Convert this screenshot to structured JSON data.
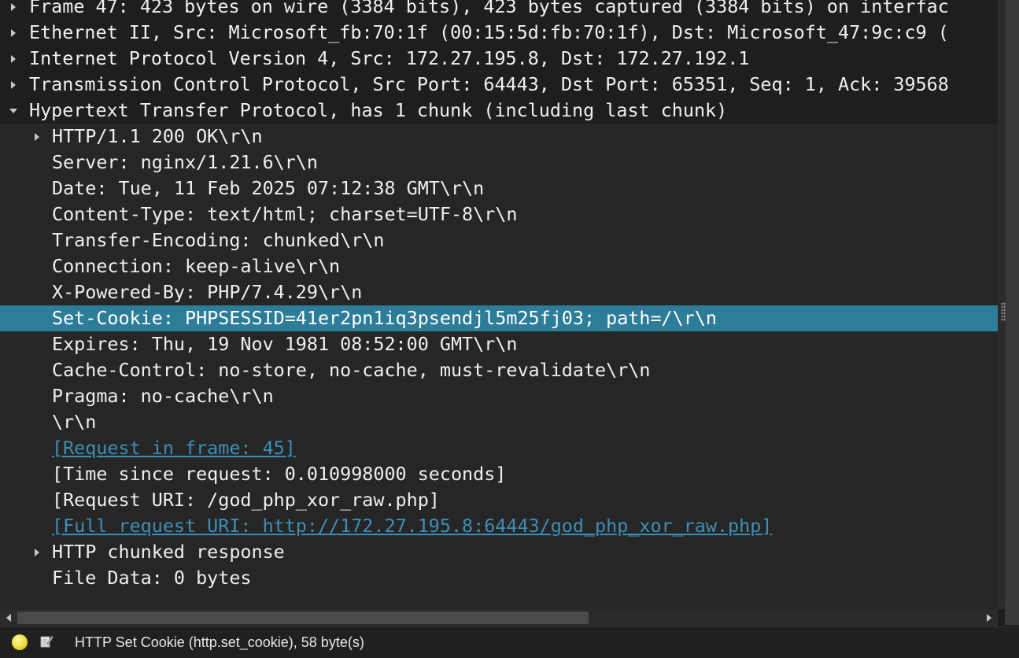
{
  "tree": {
    "top_rows": [
      {
        "text": "Frame 47: 423 bytes on wire (3384 bits), 423 bytes captured (3384 bits) on interfac",
        "expanded": false
      },
      {
        "text": "Ethernet II, Src: Microsoft_fb:70:1f (00:15:5d:fb:70:1f), Dst: Microsoft_47:9c:c9 (",
        "expanded": false
      },
      {
        "text": "Internet Protocol Version 4, Src: 172.27.195.8, Dst: 172.27.192.1",
        "expanded": false
      },
      {
        "text": "Transmission Control Protocol, Src Port: 64443, Dst Port: 65351, Seq: 1, Ack: 39568",
        "expanded": false
      },
      {
        "text": "Hypertext Transfer Protocol, has 1 chunk (including last chunk)",
        "expanded": true
      }
    ],
    "http_rows": [
      {
        "text": "HTTP/1.1 200 OK\\r\\n",
        "has_arrow": true,
        "link": false,
        "selected": false
      },
      {
        "text": "Server: nginx/1.21.6\\r\\n",
        "has_arrow": false,
        "link": false,
        "selected": false
      },
      {
        "text": "Date: Tue, 11 Feb 2025 07:12:38 GMT\\r\\n",
        "has_arrow": false,
        "link": false,
        "selected": false
      },
      {
        "text": "Content-Type: text/html; charset=UTF-8\\r\\n",
        "has_arrow": false,
        "link": false,
        "selected": false
      },
      {
        "text": "Transfer-Encoding: chunked\\r\\n",
        "has_arrow": false,
        "link": false,
        "selected": false
      },
      {
        "text": "Connection: keep-alive\\r\\n",
        "has_arrow": false,
        "link": false,
        "selected": false
      },
      {
        "text": "X-Powered-By: PHP/7.4.29\\r\\n",
        "has_arrow": false,
        "link": false,
        "selected": false
      },
      {
        "text": "Set-Cookie: PHPSESSID=41er2pn1iq3psendjl5m25fj03; path=/\\r\\n",
        "has_arrow": false,
        "link": false,
        "selected": true
      },
      {
        "text": "Expires: Thu, 19 Nov 1981 08:52:00 GMT\\r\\n",
        "has_arrow": false,
        "link": false,
        "selected": false
      },
      {
        "text": "Cache-Control: no-store, no-cache, must-revalidate\\r\\n",
        "has_arrow": false,
        "link": false,
        "selected": false
      },
      {
        "text": "Pragma: no-cache\\r\\n",
        "has_arrow": false,
        "link": false,
        "selected": false
      },
      {
        "text": "\\r\\n",
        "has_arrow": false,
        "link": false,
        "selected": false
      },
      {
        "text": "[Request in frame: 45]",
        "has_arrow": false,
        "link": true,
        "selected": false
      },
      {
        "text": "[Time since request: 0.010998000 seconds]",
        "has_arrow": false,
        "link": false,
        "selected": false
      },
      {
        "text": "[Request URI: /god_php_xor_raw.php]",
        "has_arrow": false,
        "link": false,
        "selected": false
      },
      {
        "text": "[Full request URI: http://172.27.195.8:64443/god_php_xor_raw.php]",
        "has_arrow": false,
        "link": true,
        "selected": false
      },
      {
        "text": "HTTP chunked response",
        "has_arrow": true,
        "link": false,
        "selected": false
      },
      {
        "text": "File Data: 0 bytes",
        "has_arrow": false,
        "link": false,
        "selected": false
      }
    ]
  },
  "statusbar": {
    "field_info": "HTTP Set Cookie (http.set_cookie), 58 byte(s)",
    "led_icon": "expert-info-led-icon",
    "edit_icon": "edit-comment-icon",
    "led_color": "#f2e24a"
  },
  "colors": {
    "selection": "#2d7c98",
    "link": "#3d8fb8",
    "background": "#1e1e1e"
  }
}
